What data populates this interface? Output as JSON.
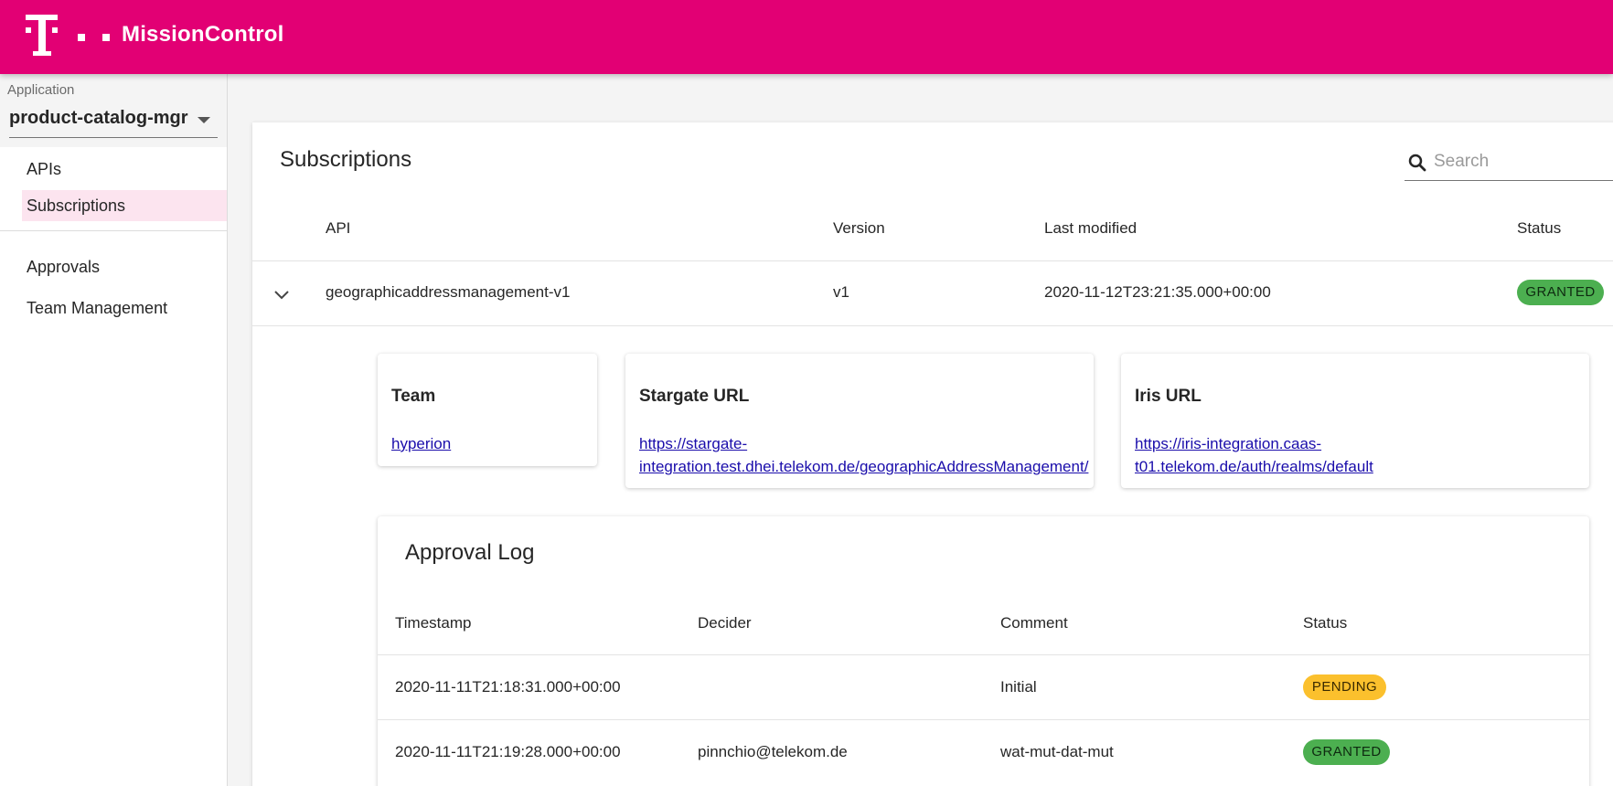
{
  "header": {
    "title": "MissionControl",
    "brand_color": "#e20074",
    "logo_icon": "telekom-logo-icon"
  },
  "sidebar": {
    "app_select": {
      "label": "Application",
      "value": "product-catalog-mgr"
    },
    "items": [
      {
        "label": "APIs",
        "active": false
      },
      {
        "label": "Subscriptions",
        "active": true
      },
      {
        "label": "Approvals",
        "active": false
      },
      {
        "label": "Team Management",
        "active": false
      }
    ]
  },
  "main": {
    "title": "Subscriptions",
    "search": {
      "placeholder": "Search",
      "value": ""
    },
    "columns": [
      "API",
      "Version",
      "Last modified",
      "Status"
    ],
    "rows": [
      {
        "api": "geographicaddressmanagement-v1",
        "version": "v1",
        "last_modified": "2020-11-12T23:21:35.000+00:00",
        "status": "GRANTED"
      }
    ],
    "details": {
      "team": {
        "title": "Team",
        "link": "hyperion"
      },
      "stargate": {
        "title": "Stargate URL",
        "link_line1": "https://stargate-",
        "link_line2": "integration.test.dhei.telekom.de/geographicAddressManagement/"
      },
      "iris": {
        "title": "Iris URL",
        "link_line1": "https://iris-integration.caas-",
        "link_line2": "t01.telekom.de/auth/realms/default"
      }
    },
    "approval_log": {
      "title": "Approval Log",
      "columns": [
        "Timestamp",
        "Decider",
        "Comment",
        "Status"
      ],
      "rows": [
        {
          "timestamp": "2020-11-11T21:18:31.000+00:00",
          "decider": "",
          "comment": "Initial",
          "status": "PENDING"
        },
        {
          "timestamp": "2020-11-11T21:19:28.000+00:00",
          "decider": "pinnchio@telekom.de",
          "comment": "wat-mut-dat-mut",
          "status": "GRANTED"
        }
      ]
    }
  },
  "colors": {
    "granted": "#4caf50",
    "pending": "#fbc02d",
    "active_nav": "#fce4ef"
  }
}
